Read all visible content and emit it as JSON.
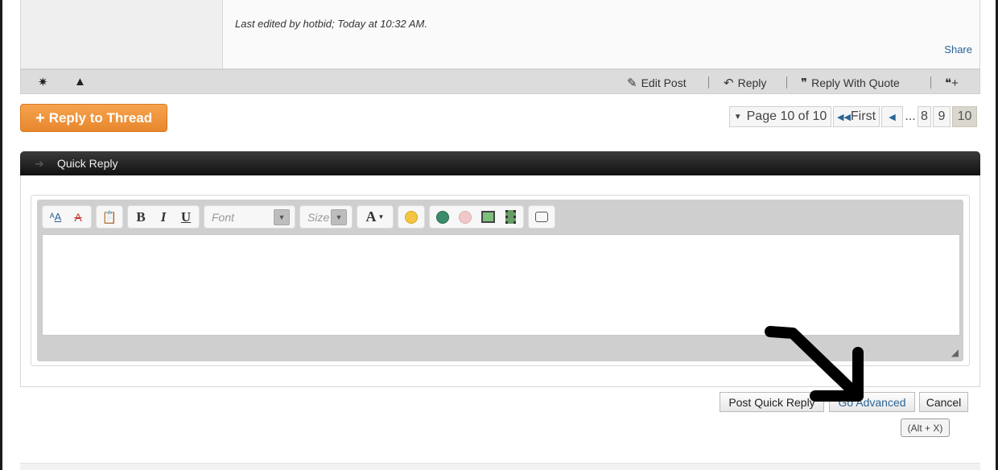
{
  "post": {
    "last_edited": "Last edited by hotbid; Today at 10:32 AM.",
    "share": "Share"
  },
  "post_actions": {
    "edit_post": "Edit Post",
    "reply": "Reply",
    "reply_with_quote": "Reply With Quote"
  },
  "reply_to_thread": "Reply to Thread",
  "pagination": {
    "page_label": "Page 10 of 10",
    "first": "First",
    "ellipsis": "...",
    "pages": [
      "8",
      "9",
      "10"
    ],
    "current": "10"
  },
  "quick_reply": {
    "title": "Quick Reply",
    "font_placeholder": "Font",
    "size_placeholder": "Size",
    "body": ""
  },
  "buttons": {
    "post_quick_reply": "Post Quick Reply",
    "go_advanced": "Go Advanced",
    "cancel": "Cancel",
    "shortcut_hint": "(Alt + X)"
  },
  "icons": {
    "post_footer_left": [
      "star-icon",
      "warning-icon"
    ],
    "edit": "pencil-icon",
    "reply": "reply-arrow-icon",
    "quote": "quote-bubble-icon",
    "multiquote": "multiquote-plus-icon"
  },
  "colors": {
    "reply_button": "#e8872d",
    "link": "#2a6496",
    "header_dark": "#111111"
  }
}
